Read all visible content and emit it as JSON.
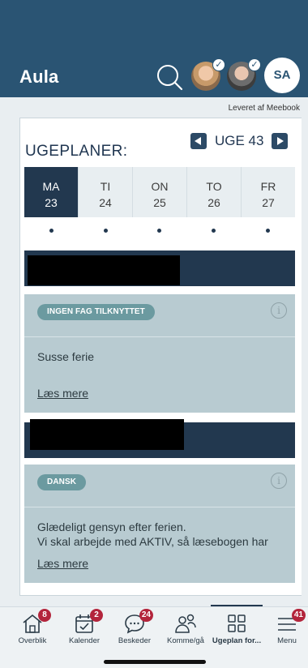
{
  "header": {
    "app_title": "Aula",
    "user_initials": "SA"
  },
  "provider_text": "Leveret af Meebook",
  "weekplan": {
    "title": "UGEPLANER:",
    "week_label": "UGE 43",
    "days": [
      {
        "name": "MA",
        "date": "23",
        "active": true
      },
      {
        "name": "TI",
        "date": "24",
        "active": false
      },
      {
        "name": "ON",
        "date": "25",
        "active": false
      },
      {
        "name": "TO",
        "date": "26",
        "active": false
      },
      {
        "name": "FR",
        "date": "27",
        "active": false
      }
    ],
    "entries": [
      {
        "tag": "INGEN FAG TILKNYTTET",
        "text_line1": "Susse ferie",
        "text_line2": "",
        "read_more": "Læs mere"
      },
      {
        "tag": "DANSK",
        "text_line1": "Glædeligt gensyn efter ferien.",
        "text_line2": "Vi skal arbejde med AKTIV, så læsebogen har",
        "read_more": "Læs mere"
      }
    ]
  },
  "tabbar": {
    "tabs": [
      {
        "label": "Overblik",
        "badge": "8",
        "icon": "home-icon"
      },
      {
        "label": "Kalender",
        "badge": "2",
        "icon": "calendar-icon"
      },
      {
        "label": "Beskeder",
        "badge": "24",
        "icon": "chat-icon"
      },
      {
        "label": "Komme/gå",
        "badge": "",
        "icon": "people-icon"
      },
      {
        "label": "Ugeplan for...",
        "badge": "",
        "icon": "grid-icon"
      },
      {
        "label": "Menu",
        "badge": "41",
        "icon": "menu-icon"
      }
    ],
    "active_index": 4
  },
  "colors": {
    "header_bg": "#2a5473",
    "active_day": "#22384f",
    "entry_bg": "#b8cbd1",
    "badge": "#b3253c"
  }
}
